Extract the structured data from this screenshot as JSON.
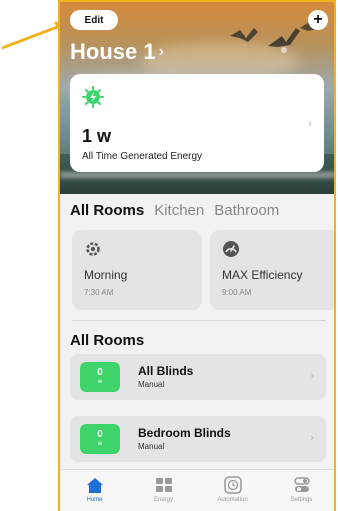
{
  "header": {
    "edit_label": "Edit",
    "add_label": "+",
    "house_title": "House 1",
    "title_chevron": "›"
  },
  "energy": {
    "value": "1 w",
    "label": "All Time Generated Energy",
    "chevron": "›"
  },
  "tabs": [
    {
      "label": "All Rooms",
      "active": true
    },
    {
      "label": "Kitchen",
      "active": false
    },
    {
      "label": "Bathroom",
      "active": false
    }
  ],
  "scenes": [
    {
      "name": "Morning",
      "time": "7:30 AM",
      "icon": "gear-icon"
    },
    {
      "name": "MAX Efficiency",
      "time": "9:00 AM",
      "icon": "gauge-icon"
    }
  ],
  "rooms_section_title": "All Rooms",
  "rooms": [
    {
      "value": "0",
      "unit": "w",
      "name": "All Blinds",
      "mode": "Manual",
      "chevron": "›"
    },
    {
      "value": "0",
      "unit": "w",
      "name": "Bedroom Blinds",
      "mode": "Manual",
      "chevron": "›"
    }
  ],
  "tabbar": [
    {
      "label": "Home",
      "icon": "house-icon",
      "active": true
    },
    {
      "label": "Energy",
      "icon": "grid-icon",
      "active": false
    },
    {
      "label": "Automation",
      "icon": "clock-icon",
      "active": false
    },
    {
      "label": "Settings",
      "icon": "toggles-icon",
      "active": false
    }
  ],
  "colors": {
    "accent": "#1f6fd8",
    "tile_green": "#3fd46b",
    "annotation": "#f0b31e"
  }
}
